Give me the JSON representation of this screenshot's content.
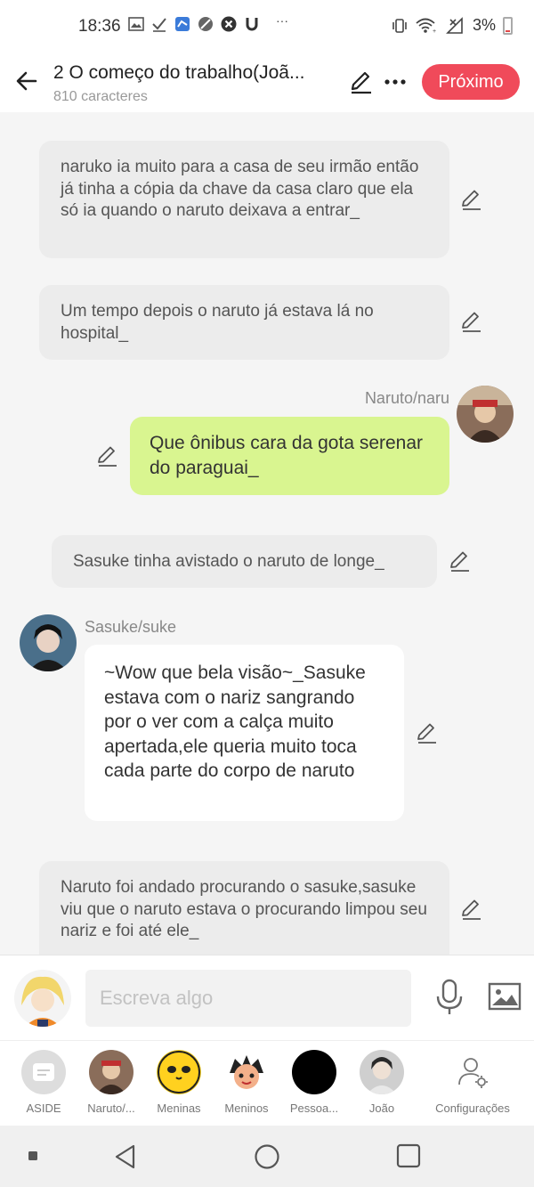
{
  "status_bar": {
    "time": "18:36",
    "overflow": "···",
    "battery": "3%"
  },
  "header": {
    "title": "2 O começo do trabalho(Joã...",
    "subtitle": "810 caracteres",
    "next_label": "Próximo"
  },
  "messages": {
    "m1": "naruko ia muito para a casa de seu irmão então já tinha a cópia da chave da casa claro que ela só ia quando o naruto deixava a entrar_",
    "m2": "Um tempo depois o naruto já estava lá no hospital_",
    "m3_speaker": "Naruto/naru",
    "m3": "Que ônibus cara da gota serenar do paraguai_",
    "m4": "Sasuke tinha avistado o naruto  de longe_",
    "m5_speaker": "Sasuke/suke",
    "m5": "~Wow que bela visão~_Sasuke estava com o nariz sangrando por o ver com a calça muito apertada,ele queria muito toca cada parte do corpo de naruto",
    "m6": "Naruto foi andado procurando o sasuke,sasuke viu que o naruto estava o procurando limpou seu nariz e foi até ele_"
  },
  "input": {
    "placeholder": "Escreva algo"
  },
  "characters": [
    {
      "label": "ASIDE"
    },
    {
      "label": "Naruto/..."
    },
    {
      "label": "Meninas"
    },
    {
      "label": "Meninos"
    },
    {
      "label": "Pessoa..."
    },
    {
      "label": "João"
    },
    {
      "label": "Configurações"
    }
  ],
  "colors": {
    "accent": "#f04a5a",
    "user_bubble": "#d9f590",
    "narration_bubble": "#ececec"
  }
}
